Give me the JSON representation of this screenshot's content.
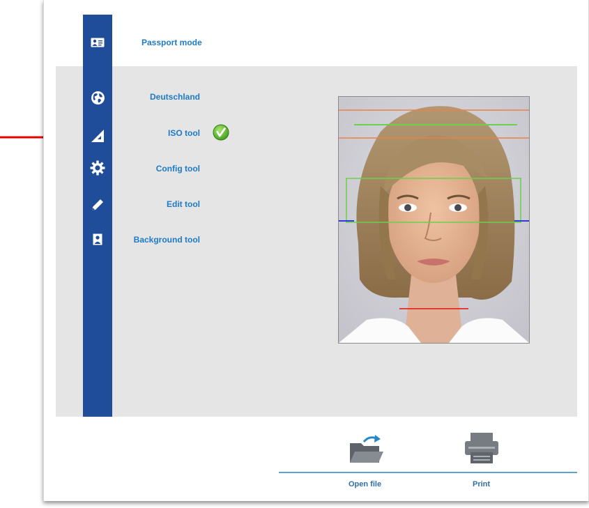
{
  "header": {
    "mode_label": "Passport mode"
  },
  "menu": {
    "items": [
      {
        "label": "Deutschland"
      },
      {
        "label": "ISO tool"
      },
      {
        "label": "Config tool"
      },
      {
        "label": "Edit tool"
      },
      {
        "label": "Background tool"
      }
    ]
  },
  "iso_status_icon": "checkmark-badge-icon",
  "actions": {
    "open_file_label": "Open file",
    "print_label": "Print"
  },
  "colors": {
    "sidebar": "#1f4d99",
    "accent_text": "#1e7ac6",
    "guide_orange": "#e8824a",
    "guide_green": "#6bd04a",
    "guide_blue": "#2c3bd6",
    "guide_red": "#e33a36",
    "annotation_arrow": "#e60000"
  }
}
